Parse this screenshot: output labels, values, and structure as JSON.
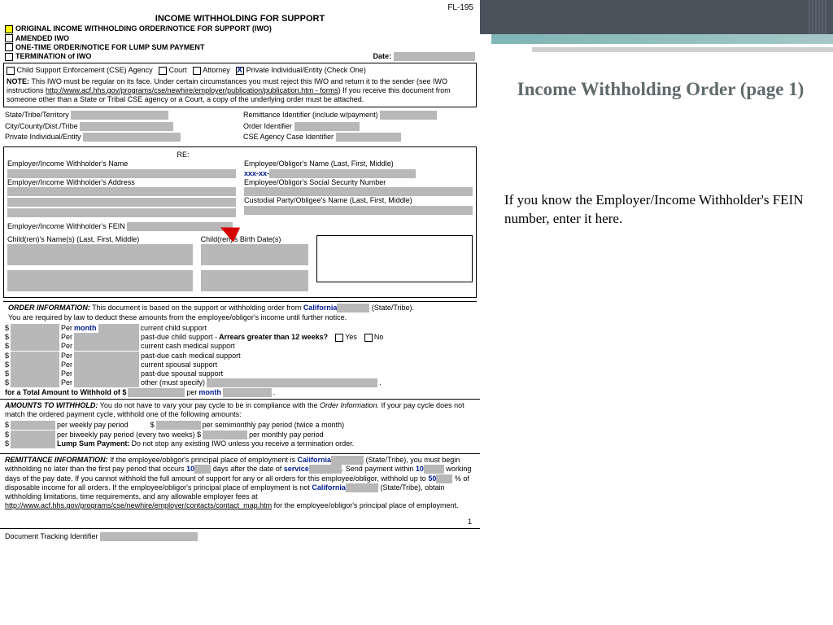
{
  "form_code": "FL-195",
  "header_title": "INCOME WITHHOLDING FOR SUPPORT",
  "checkboxes": {
    "original": "ORIGINAL INCOME WITHHOLDING ORDER/NOTICE FOR SUPPORT (IWO)",
    "amended": "AMENDED IWO",
    "onetime": "ONE-TIME ORDER/NOTICE FOR LUMP SUM PAYMENT",
    "termination": "TERMINATION of IWO"
  },
  "date_label": "Date:",
  "agency_row": {
    "cse": "Child Support Enforcement (CSE) Agency",
    "court": "Court",
    "attorney": "Attorney",
    "private": "Private Individual/Entity  (Check One)"
  },
  "note": {
    "label": "NOTE:",
    "body1": " This IWO must be regular on its face. Under certain circumstances you must reject this IWO and return it to the sender (see IWO instructions ",
    "link": "http://www.acf.hhs.gov/programs/cse/newhire/employer/publication/publication.htm - forms",
    "body2": ") If you receive this document from someone other than a State or Tribal CSE agency or a Court, a copy of the underlying order must be attached."
  },
  "idfields": {
    "l1": "State/Tribe/Territory",
    "l2": "City/County/Dist./Tribe",
    "l3": "Private Individual/Entity",
    "r1": "Remittance Identifier (include w/payment)",
    "r2": "Order Identifier",
    "r3": "CSE Agency Case Identifier"
  },
  "re": "RE:",
  "parties": {
    "emp_name": "Employer/Income Withholder's Name",
    "emp_addr": "Employer/Income Withholder's Address",
    "emp_fein": "Employer/Income Withholder's FEIN",
    "obl_name": "Employee/Obligor's Name (Last, First, Middle)",
    "ssn_mask": "xxx-xx-",
    "obl_ssn": "Employee/Obligor's Social Security Number",
    "cust_name": "Custodial Party/Obligee's Name (Last, First, Middle)",
    "child_name": "Child(ren)'s Name(s) (Last, First, Middle)",
    "child_dob": "Child(ren)'s Birth Date(s)"
  },
  "order": {
    "heading": "ORDER INFORMATION:",
    "intro1": " This document is based on the support or withholding order from  ",
    "state": "California",
    "state_tribe": "(State/Tribe).",
    "intro2": "You are required by law to deduct these amounts from the employee/obligor's income until further notice.",
    "per": "Per",
    "month": "month",
    "items": {
      "ccs": "current child support",
      "pdcs": "past-due child support -   ",
      "arrears_q": "Arrears greater than 12 weeks?",
      "yes": "Yes",
      "no": "No",
      "ccms": "current cash medical support",
      "pdcms": "past-due cash medical support",
      "css": "current spousal support",
      "pdss": "past-due spousal support",
      "other": "other (must specify)"
    },
    "total": "for a  Total Amount to Withhold of $",
    "per2": "per"
  },
  "amounts": {
    "heading": "AMOUNTS TO WITHHOLD:",
    "body": " You do not have to vary your pay cycle to be in compliance with the ",
    "ital": "Order Information.",
    "body2": " If your pay cycle does not match the ordered payment cycle, withhold one of the following amounts:",
    "wk": "per weekly pay period",
    "sm": "per semimonthly pay period (twice a month)",
    "bw": "per biweekly pay period (every two weeks) $",
    "mo": "per monthly pay period",
    "lump_lbl": "Lump Sum Payment:",
    "lump_txt": " Do not stop any existing IWO unless you receive a termination order."
  },
  "remit": {
    "heading": "REMITTANCE INFORMATION:",
    "b1": " If the employee/obligor's principal place of employment is  ",
    "state": "California",
    "st": "(State/Tribe),",
    "b2": "you must begin withholding no later than the first pay period that occurs",
    "v10": "10",
    "b3": "days after the date of ",
    "service": "service",
    "b4": ". Send payment within ",
    "b5": " working days of the pay date. If you cannot withhold the full amount of support for any or all orders for this employee/obligor, withhold up to ",
    "v50": "50",
    "b6": " % of disposable income for all orders. If the employee/obligor's principal place of employment is not  ",
    "b7": " (State/Tribe), obtain withholding limitations, time requirements, and any allowable employer fees at ",
    "link": "http://www.acf.hhs.gov/programs/cse/newhire/employer/contacts/contact_map.htm",
    "b8": " for the employee/obligor's principal place of employment."
  },
  "page_no": "1",
  "dti": "Document Tracking Identifier",
  "side": {
    "title": "Income Withholding Order (page 1)",
    "body": "If you know the Employer/Income Withholder's FEIN number, enter it here."
  }
}
